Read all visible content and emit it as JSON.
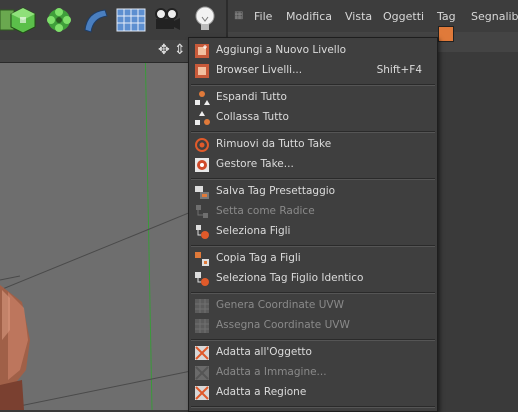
{
  "menubar": {
    "items": [
      "File",
      "Modifica",
      "Vista",
      "Oggetti",
      "Tag",
      "Segnalibri"
    ]
  },
  "dropdown": {
    "items": [
      {
        "label": "Aggiungi a Nuovo Livello",
        "shortcut": "",
        "enabled": true,
        "icon": "layer-add-icon"
      },
      {
        "label": "Browser Livelli...",
        "shortcut": "Shift+F4",
        "enabled": true,
        "icon": "layer-browser-icon"
      },
      {
        "label": "Espandi Tutto",
        "shortcut": "",
        "enabled": true,
        "icon": "expand-all-icon"
      },
      {
        "label": "Collassa Tutto",
        "shortcut": "",
        "enabled": true,
        "icon": "collapse-all-icon"
      },
      {
        "label": "Rimuovi da Tutto Take",
        "shortcut": "",
        "enabled": true,
        "icon": "take-remove-icon"
      },
      {
        "label": "Gestore Take...",
        "shortcut": "",
        "enabled": true,
        "icon": "take-manager-icon"
      },
      {
        "label": "Salva Tag Presettaggio",
        "shortcut": "",
        "enabled": true,
        "icon": "tag-preset-icon"
      },
      {
        "label": "Setta come Radice",
        "shortcut": "",
        "enabled": false,
        "icon": "set-root-icon"
      },
      {
        "label": "Seleziona Figli",
        "shortcut": "",
        "enabled": true,
        "icon": "select-children-icon"
      },
      {
        "label": "Copia Tag a Figli",
        "shortcut": "",
        "enabled": true,
        "icon": "copy-tag-icon"
      },
      {
        "label": "Seleziona Tag Figlio Identico",
        "shortcut": "",
        "enabled": true,
        "icon": "select-tag-icon"
      },
      {
        "label": "Genera Coordinate UVW",
        "shortcut": "",
        "enabled": false,
        "icon": "uvw-generate-icon"
      },
      {
        "label": "Assegna Coordinate UVW",
        "shortcut": "",
        "enabled": false,
        "icon": "uvw-assign-icon"
      },
      {
        "label": "Adatta all'Oggetto",
        "shortcut": "",
        "enabled": true,
        "icon": "fit-object-icon"
      },
      {
        "label": "Adatta a Immagine...",
        "shortcut": "",
        "enabled": false,
        "icon": "fit-image-icon"
      },
      {
        "label": "Adatta a Regione",
        "shortcut": "",
        "enabled": true,
        "icon": "fit-region-icon"
      }
    ]
  },
  "colors": {
    "accent": "#e07a3a",
    "viewport_bg": "#6e6e6e",
    "menu_bg": "#3f3f3f",
    "disabled_text": "#8a8a8a"
  }
}
